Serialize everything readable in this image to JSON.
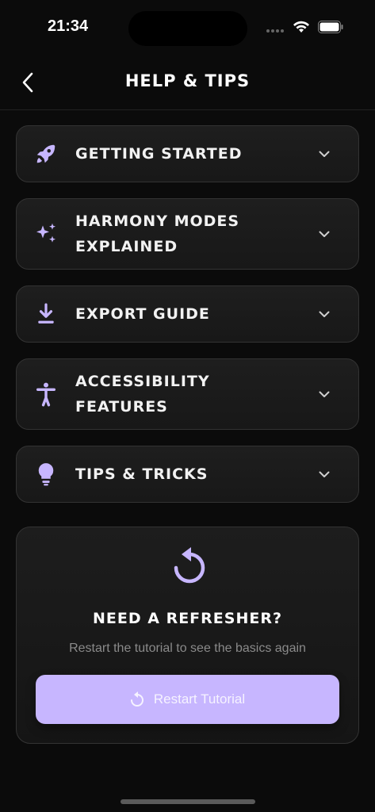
{
  "status": {
    "time": "21:34"
  },
  "header": {
    "title": "HELP & TIPS"
  },
  "sections": [
    {
      "label": "GETTING STARTED",
      "icon": "rocket-icon"
    },
    {
      "label": "HARMONY MODES EXPLAINED",
      "icon": "sparkles-icon"
    },
    {
      "label": "EXPORT GUIDE",
      "icon": "download-icon"
    },
    {
      "label": "ACCESSIBILITY FEATURES",
      "icon": "accessibility-icon"
    },
    {
      "label": "TIPS & TRICKS",
      "icon": "lightbulb-icon"
    }
  ],
  "refresher": {
    "title": "NEED A REFRESHER?",
    "subtitle": "Restart the tutorial to see the basics again",
    "button_label": "Restart Tutorial"
  },
  "colors": {
    "accent": "#c7b6ff",
    "background": "#0b0b0b",
    "card": "#1c1c1c"
  }
}
